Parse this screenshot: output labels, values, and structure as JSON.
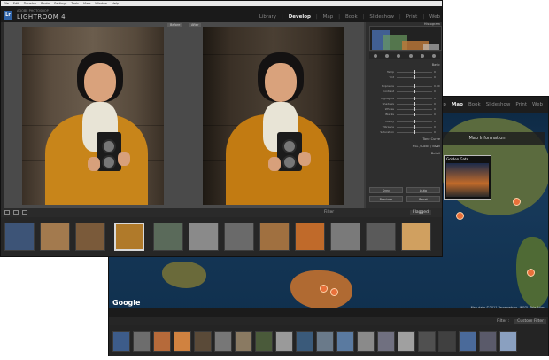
{
  "develop": {
    "menu_items": [
      "File",
      "Edit",
      "Develop",
      "Photo",
      "Settings",
      "Tools",
      "View",
      "Window",
      "Help"
    ],
    "app_subtitle": "ADOBE PHOTOSHOP",
    "app_title": "LIGHTROOM 4",
    "logo_text": "Lr",
    "modules": [
      "Library",
      "Develop",
      "Map",
      "Book",
      "Slideshow",
      "Print",
      "Web"
    ],
    "active_module": "Develop",
    "before_label": "Before",
    "after_label": "After",
    "histogram_label": "Histogram",
    "panel_sections": {
      "basic": "Basic",
      "tone_curve": "Tone Curve",
      "hsl": "HSL / Color / B&W",
      "detail": "Detail"
    },
    "sliders": [
      {
        "label": "Temp",
        "value": "0"
      },
      {
        "label": "Tint",
        "value": "0"
      },
      {
        "label": "Exposure",
        "value": "0.00"
      },
      {
        "label": "Contrast",
        "value": "0"
      },
      {
        "label": "Highlights",
        "value": "0"
      },
      {
        "label": "Shadows",
        "value": "0"
      },
      {
        "label": "Whites",
        "value": "0"
      },
      {
        "label": "Blacks",
        "value": "0"
      },
      {
        "label": "Clarity",
        "value": "0"
      },
      {
        "label": "Vibrance",
        "value": "0"
      },
      {
        "label": "Saturation",
        "value": "0"
      }
    ],
    "buttons": {
      "previous": "Previous",
      "reset": "Reset",
      "sync": "Sync",
      "auto": "Auto"
    },
    "filter_label": "Filter :",
    "filter_value": "Flagged"
  },
  "map": {
    "modules": [
      "Develop",
      "Map",
      "Book",
      "Slideshow",
      "Print",
      "Web"
    ],
    "active_module": "Map",
    "info_panel": "Map Information",
    "popup_caption": "Golden Gate",
    "google_label": "Google",
    "attribution": "Map data ©2011 Terrametrics, INEGI, Tele Atlas",
    "filter_label": "Filter :",
    "filter_value": "Custom Filter"
  }
}
